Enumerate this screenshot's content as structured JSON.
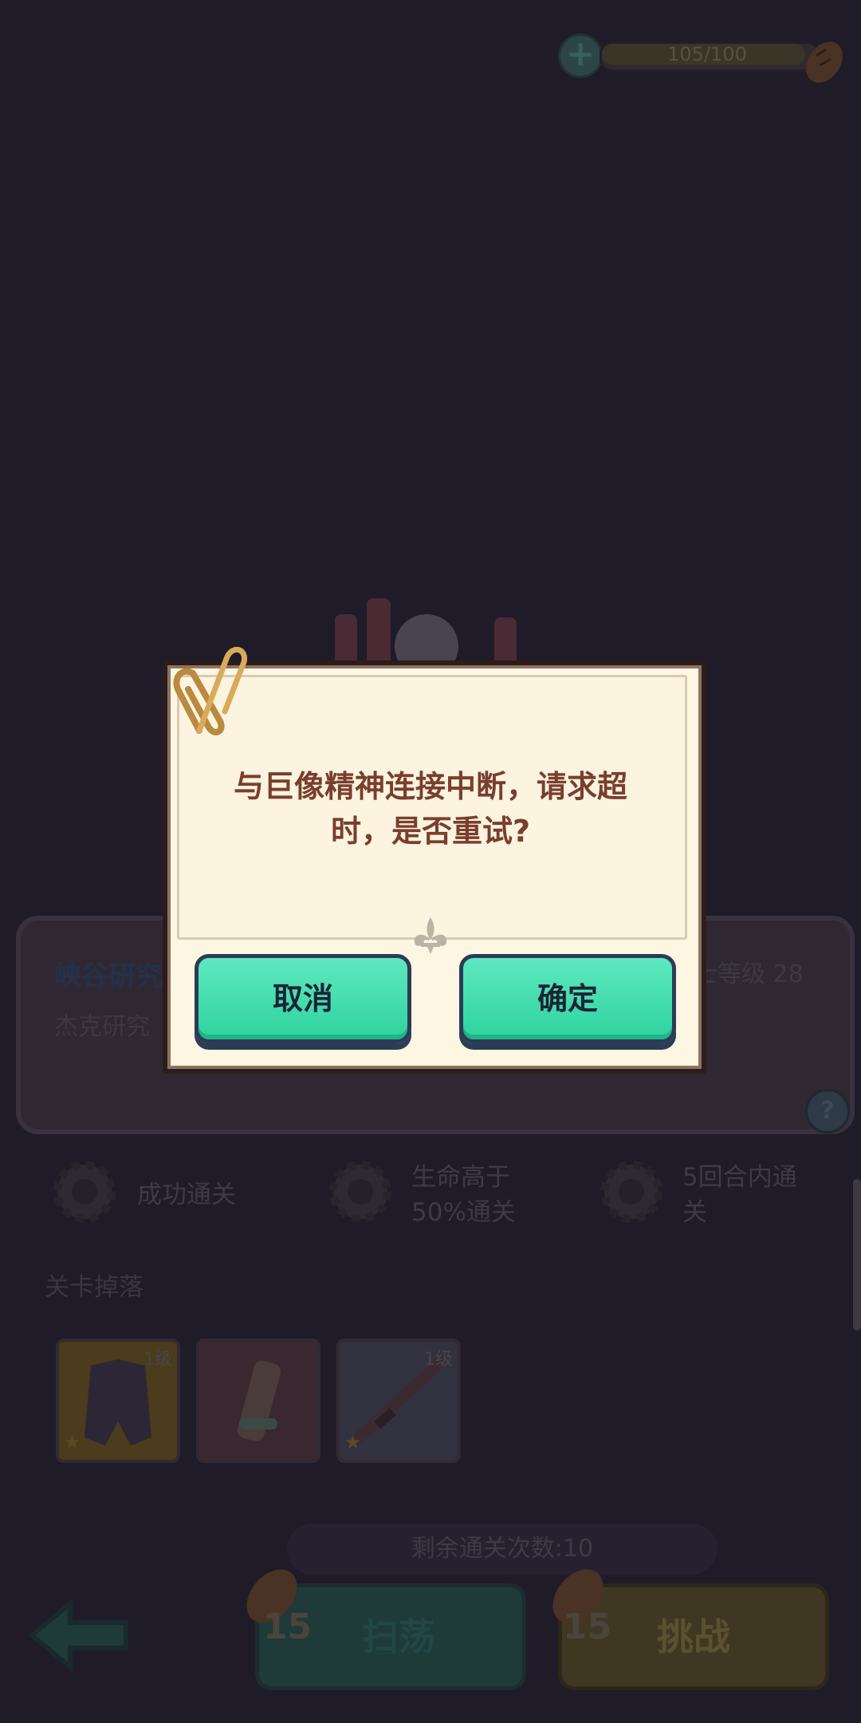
{
  "energy": {
    "text": "105/100",
    "icon": "bread-icon"
  },
  "stage_card": {
    "title": "峡谷研究",
    "subtitle": "杰克研究",
    "level_label": "士等级 28"
  },
  "objectives": [
    {
      "label": "成功通关"
    },
    {
      "label": "生命高于\n50%通关"
    },
    {
      "label": "5回合内通\n关"
    }
  ],
  "drops": {
    "section_label": "关卡掉落",
    "items": [
      {
        "icon": "armor-icon",
        "level": "1级",
        "bg": "#4a3c1c"
      },
      {
        "icon": "scroll-icon",
        "level": "",
        "bg": "#3a2830"
      },
      {
        "icon": "rifle-icon",
        "level": "1级",
        "bg": "#323140"
      }
    ]
  },
  "remaining": "剩余通关次数:10",
  "sweep": {
    "cost": "15",
    "label": "扫荡"
  },
  "challenge": {
    "cost": "15",
    "label": "挑战"
  },
  "dialog": {
    "message": "与巨像精神连接中断，请求超时，是否重试?",
    "cancel_label": "取消",
    "confirm_label": "确定"
  },
  "colors": {
    "background": "#1f1b29",
    "dialog_paper": "#fdf6e3",
    "dialog_text": "#7a3e2f",
    "button_green": "#3ddcab"
  }
}
